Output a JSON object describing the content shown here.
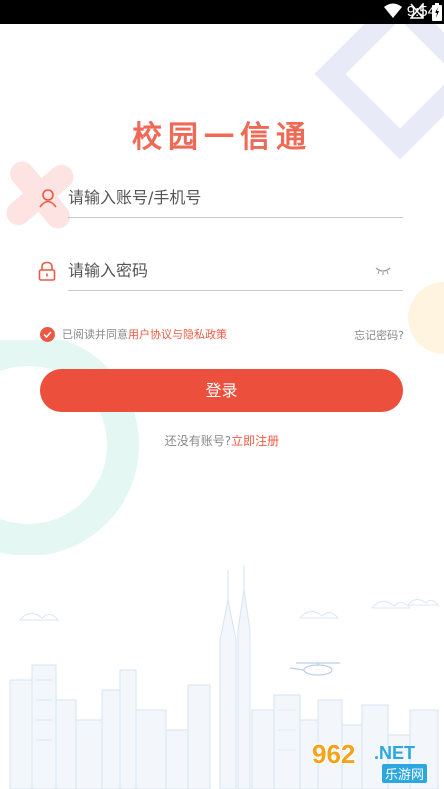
{
  "status_bar": {
    "time": "9:54"
  },
  "app": {
    "title": "校园一信通"
  },
  "form": {
    "account_placeholder": "请输入账号/手机号",
    "password_placeholder": "请输入密码"
  },
  "agreement": {
    "prefix": "已阅读并同意",
    "link": "用户协议与隐私政策",
    "checked": true
  },
  "forgot_password": "忘记密码?",
  "login_button": "登录",
  "register": {
    "prefix": "还没有账号?",
    "link": "立即注册"
  },
  "watermark": {
    "big": "962",
    "net": ".NET",
    "small": "乐游网"
  },
  "colors": {
    "accent": "#ec4f3c",
    "title": "#ef6a56"
  }
}
